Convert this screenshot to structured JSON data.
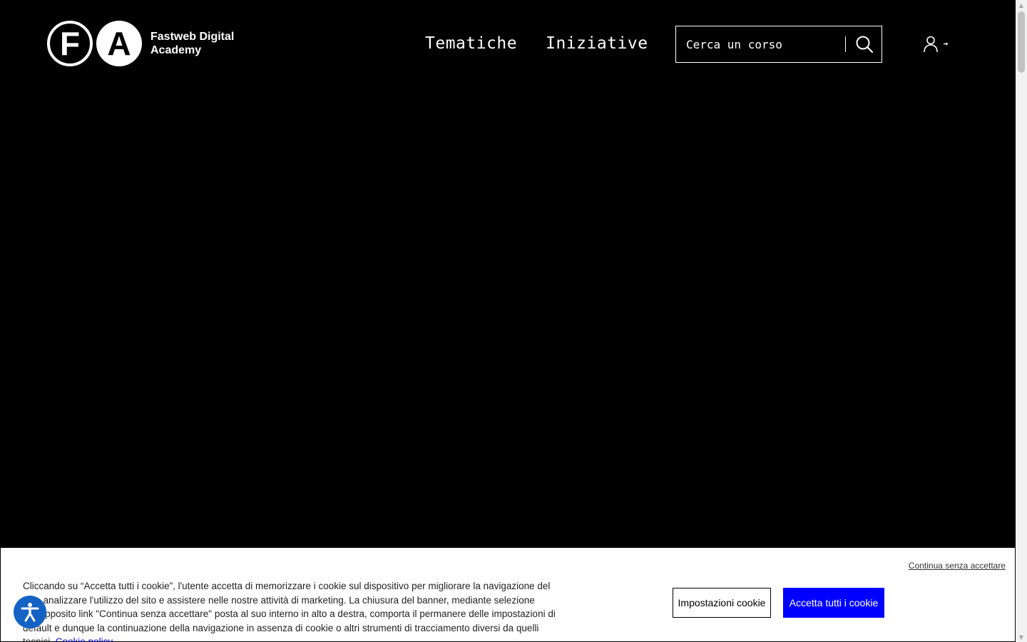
{
  "header": {
    "logo_letter_f": "F",
    "logo_letter_a": "A",
    "logo_text_line1": "Fastweb Digital",
    "logo_text_line2": "Academy",
    "nav": [
      {
        "label": "Tematiche"
      },
      {
        "label": "Iniziative"
      }
    ],
    "search": {
      "placeholder": "Cerca un corso",
      "value": ""
    },
    "login_icon": "user-login-icon"
  },
  "cookie_banner": {
    "skip_label": "Continua senza accettare",
    "text": "Cliccando su “Accetta tutti i cookie”, l'utente accetta di memorizzare i cookie sul dispositivo per migliorare la navigazione del sito, analizzare l'utilizzo del sito e assistere nelle nostre attività di marketing. La chiusura del banner, mediante selezione dell'apposito link \"Continua senza accettare\" posta al suo interno in alto a destra, comporta il permanere delle impostazioni di default e dunque la continuazione della navigazione in assenza di cookie o altri strumenti di tracciamento diversi da quelli tecnici.",
    "policy_link": "Cookie policy",
    "settings_label": "Impostazioni cookie",
    "accept_label": "Accetta tutti i cookie"
  },
  "accessibility": {
    "icon": "accessibility-icon"
  },
  "colors": {
    "background": "#000000",
    "accept_button": "#0000ff",
    "link": "#0000ee",
    "accessibility_button": "#1462c4"
  }
}
